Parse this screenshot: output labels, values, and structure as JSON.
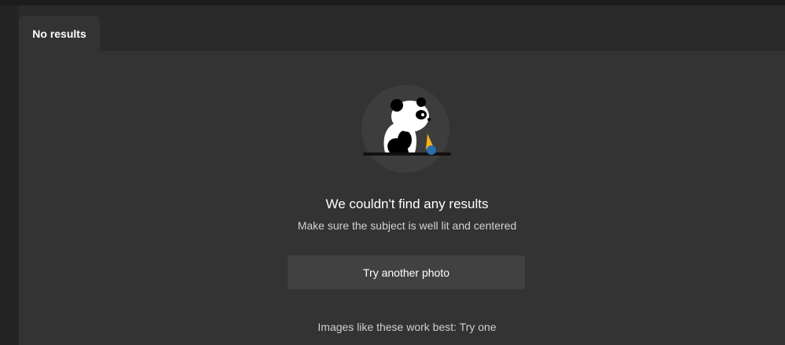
{
  "tab": {
    "label": "No results"
  },
  "empty_state": {
    "illustration": "sad-panda-icon",
    "title": "We couldn't find any results",
    "subtitle": "Make sure the subject is well lit and centered",
    "button_label": "Try another photo",
    "hint": "Images like these work best: Try one"
  },
  "colors": {
    "background": "#202020",
    "panel": "#333333",
    "button": "#414141",
    "text": "#ffffff"
  }
}
